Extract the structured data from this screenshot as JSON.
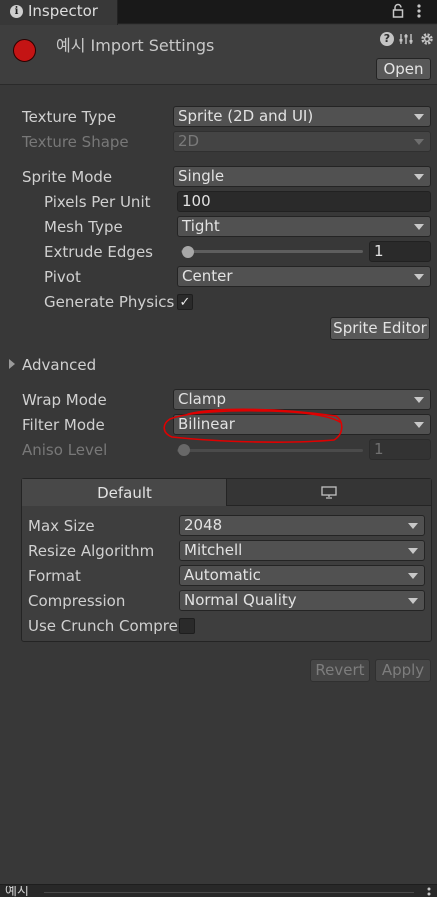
{
  "tab": {
    "title": "Inspector"
  },
  "header": {
    "asset_title": "예시 Import Settings",
    "open_label": "Open",
    "icons": [
      "lock-icon",
      "kebab-menu-icon",
      "help-icon",
      "preset-icon",
      "settings-icon"
    ]
  },
  "fields": {
    "texture_type": {
      "label": "Texture Type",
      "value": "Sprite (2D and UI)"
    },
    "texture_shape": {
      "label": "Texture Shape",
      "value": "2D"
    },
    "sprite_mode": {
      "label": "Sprite Mode",
      "value": "Single"
    },
    "pixels_per_unit": {
      "label": "Pixels Per Unit",
      "value": "100"
    },
    "mesh_type": {
      "label": "Mesh Type",
      "value": "Tight"
    },
    "extrude_edges": {
      "label": "Extrude Edges",
      "value": "1",
      "slider_fraction": 0.0
    },
    "pivot": {
      "label": "Pivot",
      "value": "Center"
    },
    "generate_physics": {
      "label": "Generate Physics",
      "checked": true,
      "check_glyph": "✓"
    },
    "sprite_editor_label": "Sprite Editor",
    "advanced_label": "Advanced",
    "wrap_mode": {
      "label": "Wrap Mode",
      "value": "Clamp"
    },
    "filter_mode": {
      "label": "Filter Mode",
      "value": "Bilinear"
    },
    "aniso_level": {
      "label": "Aniso Level",
      "value": "1",
      "slider_fraction": 0.0
    }
  },
  "platform": {
    "tabs": {
      "default_label": "Default",
      "standalone_icon": "monitor-icon"
    },
    "max_size": {
      "label": "Max Size",
      "value": "2048"
    },
    "resize_algorithm": {
      "label": "Resize Algorithm",
      "value": "Mitchell"
    },
    "format": {
      "label": "Format",
      "value": "Automatic"
    },
    "compression": {
      "label": "Compression",
      "value": "Normal Quality"
    },
    "crunch": {
      "label": "Use Crunch Compres",
      "checked": false
    }
  },
  "footer": {
    "revert_label": "Revert",
    "apply_label": "Apply"
  },
  "bottom": {
    "title": "예시"
  },
  "colors": {
    "annotation_red": "#e00000",
    "asset_icon_red": "#c41414",
    "panel_bg": "#383838"
  }
}
